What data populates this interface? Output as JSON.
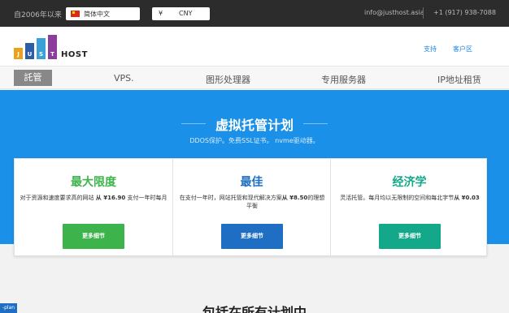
{
  "topbar": {
    "since": "自2006年以来",
    "language": "简体中文",
    "currency_symbol": "¥",
    "currency_code": "CNY",
    "email": "info@justhost.asia",
    "phone": "+1 (917) 938-7088"
  },
  "header": {
    "logo_letters": [
      "J",
      "U",
      "S",
      "T"
    ],
    "logo_host": "HOST",
    "logo_colors": [
      "#e8a21c",
      "#2a5fa8",
      "#3aa0d8",
      "#8a3d9a"
    ],
    "links": [
      "支持",
      "客户区"
    ]
  },
  "nav": {
    "items": [
      "託管",
      "VPS.",
      "图形处理器",
      "专用服务器",
      "IP地址租赁"
    ]
  },
  "hero": {
    "title": "虚拟托管计划",
    "subtitle": "DDOS保护。免费SSL证书。 nvme驱动器。"
  },
  "cards": [
    {
      "title": "最大限度",
      "desc_pre": "对于资源和速度要求高的网站 ",
      "desc_bold": "从 ¥16.90",
      "desc_post": " 支付一年时每月",
      "button": "更多细节",
      "color": "#3cb44b"
    },
    {
      "title": "最佳",
      "desc_pre": "在支付一年时，网站托管和现代解决方案",
      "desc_bold": "从 ¥8.50",
      "desc_post": "的理想平衡",
      "button": "更多细节",
      "color": "#1e6fc4"
    },
    {
      "title": "经济学",
      "desc_pre": "灵活托管。每月均以无限制的空间和每北字节",
      "desc_bold": "从 ¥0.03",
      "desc_post": "",
      "button": "更多细节",
      "color": "#14a88a"
    }
  ],
  "bottom": {
    "title": "包括在所有计划中",
    "tag": "-plan"
  }
}
